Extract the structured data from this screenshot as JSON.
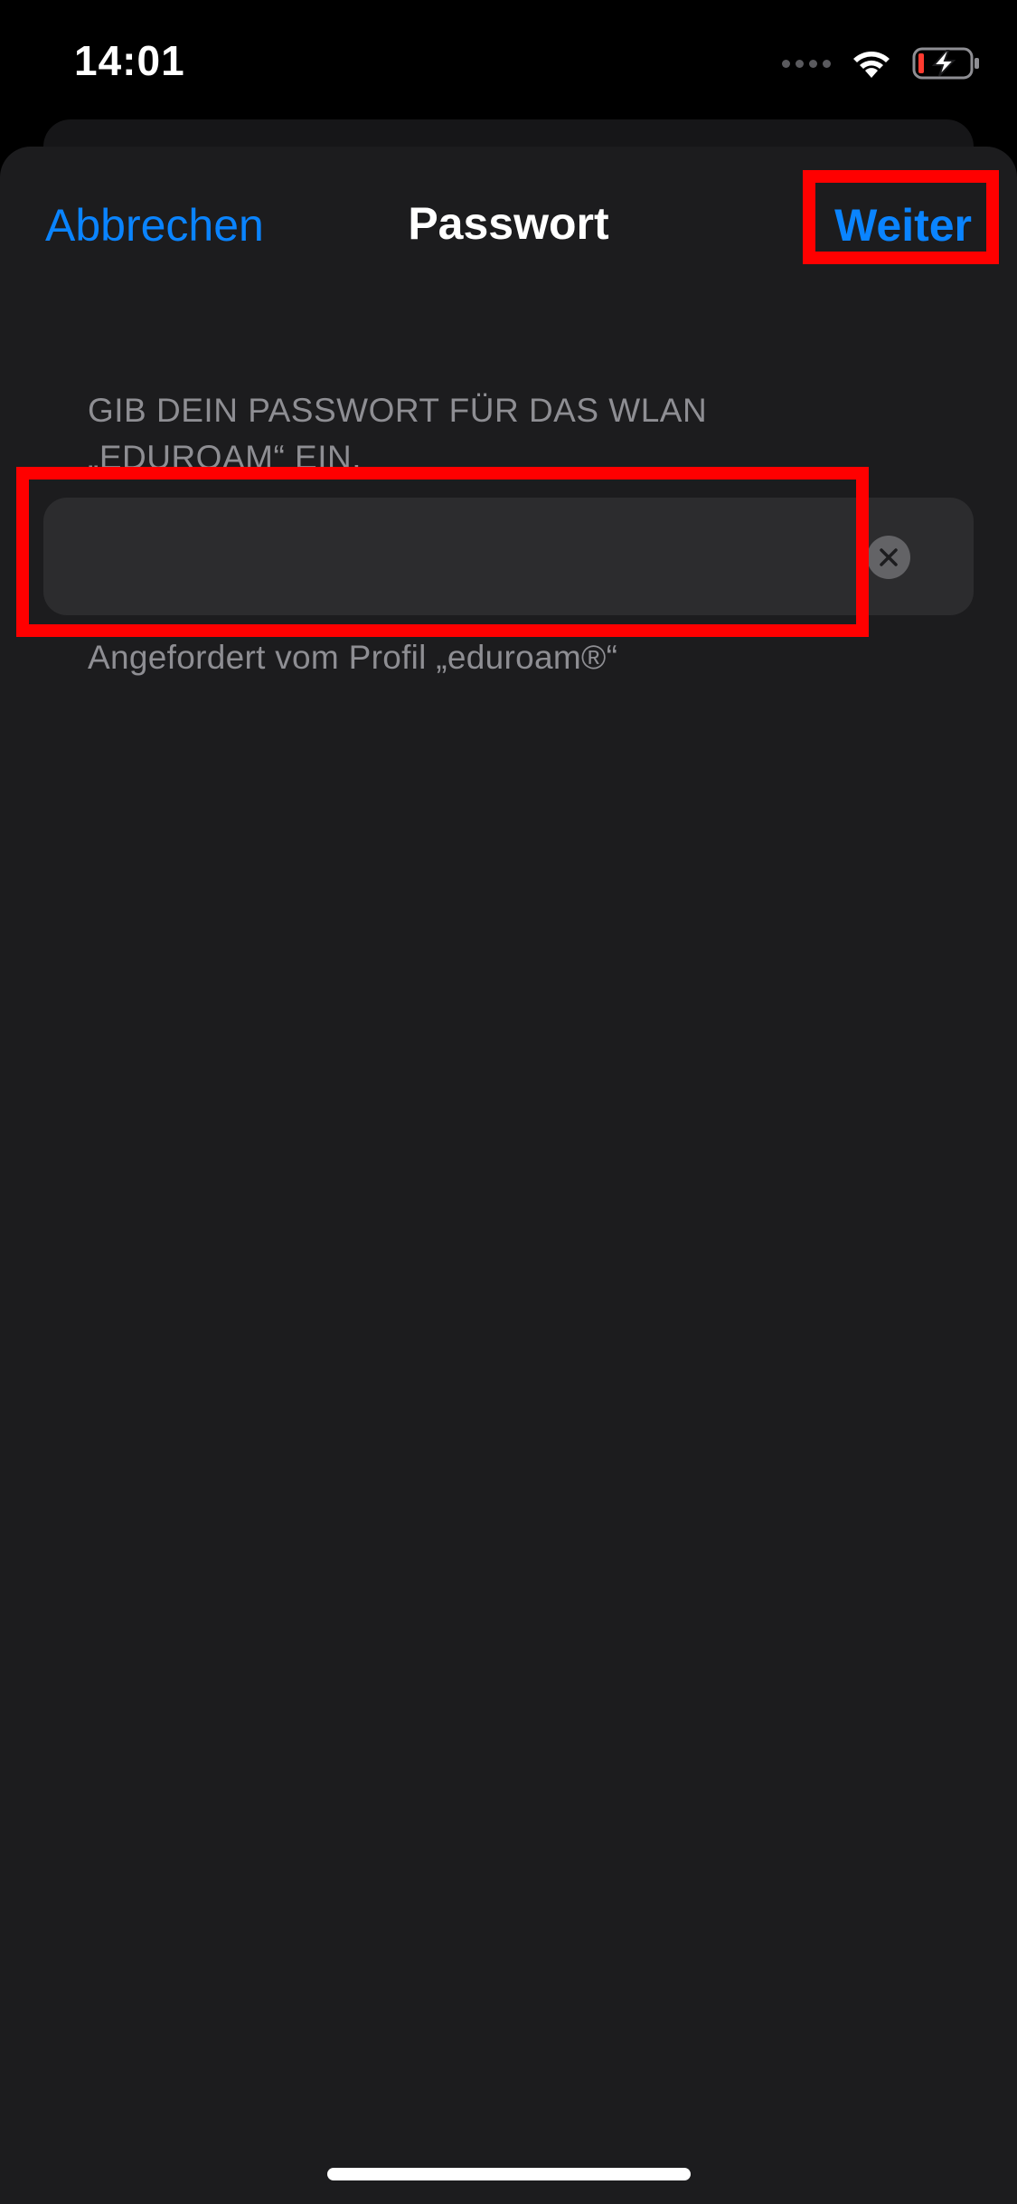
{
  "status_bar": {
    "time": "14:01",
    "icons": [
      "cellular-signal-icon",
      "wifi-icon",
      "battery-charging-icon"
    ],
    "battery_color": "#ff3b30"
  },
  "nav": {
    "cancel_label": "Abbrechen",
    "title": "Passwort",
    "next_label": "Weiter"
  },
  "form": {
    "header": "GIB DEIN PASSWORT FÜR DAS WLAN „EDUROAM“ EIN.",
    "password_value": "",
    "clear_icon": "clear-icon",
    "footer": "Angefordert vom Profil „eduroam®“"
  },
  "colors": {
    "accent": "#0a84ff",
    "sheet_background": "#1c1c1e",
    "input_background": "#2c2c2e",
    "secondary_text": "#8e8e93",
    "highlight": "#ff0000"
  }
}
